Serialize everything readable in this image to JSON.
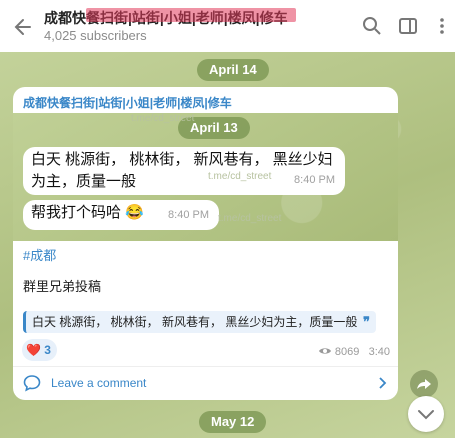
{
  "header": {
    "title": "成都快餐扫街|站街|小姐|老师|楼凤|修车",
    "subscribers": "4,025 subscribers",
    "icons": [
      "back-arrow-icon",
      "search-icon",
      "sidebar-toggle-icon",
      "more-icon"
    ]
  },
  "dates": {
    "top": "April 14",
    "bottom": "May 12"
  },
  "post": {
    "header_line": "成都快餐扫街|站街|小姐|老师|楼凤|修车",
    "screenshot": {
      "date": "April 13",
      "bubble1_text": "白天 桃源街，  桃林街，  新风巷有，  黑丝少妇为主，质量一般",
      "bubble1_time": "8:40 PM",
      "bubble2_text": "帮我打个码哈 😂",
      "bubble2_time": "8:40 PM",
      "watermark": "t.me/cd_street"
    },
    "hashtag": "#成都",
    "paragraph": "群里兄弟投稿",
    "quote": "白天 桃源街，  桃林街，  新风巷有，  黑丝少妇为主，质量一般",
    "reaction_emoji": "❤️",
    "reaction_count": "3",
    "views": "8069",
    "time": "3:40",
    "comment_label": "Leave a comment"
  },
  "colors": {
    "accent": "#3a87c8",
    "bg": "#b9c98f"
  }
}
